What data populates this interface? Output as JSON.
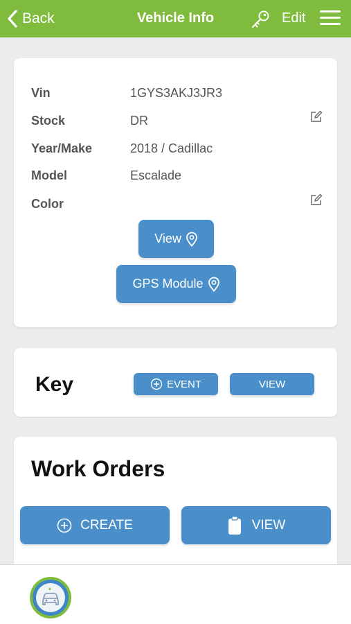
{
  "header": {
    "back_label": "Back",
    "title": "Vehicle Info",
    "edit_label": "Edit",
    "color": "#7fbc3d"
  },
  "vehicle": {
    "fields": [
      {
        "label": "Vin",
        "value": "1GYS3AKJ3JR3",
        "editable": false
      },
      {
        "label": "Stock",
        "value": "DR",
        "editable": true
      },
      {
        "label": "Year/Make",
        "value": "2018 / Cadillac",
        "editable": false
      },
      {
        "label": "Model",
        "value": "Escalade",
        "editable": false
      },
      {
        "label": "Color",
        "value": "",
        "editable": true
      }
    ],
    "view_button": "View",
    "gps_button": "GPS Module"
  },
  "key": {
    "title": "Key",
    "event_button": "EVENT",
    "view_button": "VIEW"
  },
  "work_orders": {
    "title": "Work Orders",
    "create_button": "CREATE",
    "view_button": "VIEW"
  },
  "colors": {
    "accent": "#4a8fca",
    "header": "#7fbc3d",
    "background": "#ececec"
  },
  "icons": [
    "chevron-left-icon",
    "key-icon",
    "hamburger-menu-icon",
    "edit-pencil-icon",
    "location-pin-icon",
    "plus-circle-icon",
    "clipboard-icon",
    "car-avatar-icon"
  ]
}
